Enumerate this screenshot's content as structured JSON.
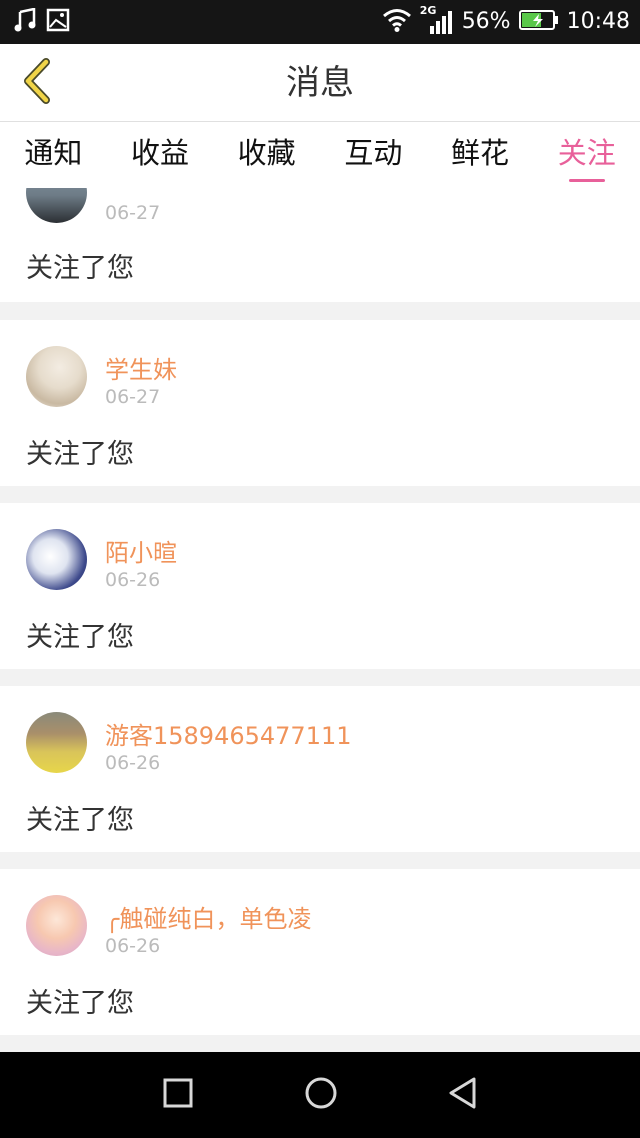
{
  "status_bar": {
    "battery": "56%",
    "time": "10:48",
    "network": "2G",
    "icons": [
      "music-icon",
      "image-icon",
      "wifi-icon",
      "signal-icon",
      "battery-icon"
    ]
  },
  "header": {
    "title": "消息",
    "back_icon": "chevron-left-icon"
  },
  "tabs": [
    {
      "label": "通知"
    },
    {
      "label": "收益"
    },
    {
      "label": "收藏"
    },
    {
      "label": "互动"
    },
    {
      "label": "鲜花"
    },
    {
      "label": "关注",
      "active": true
    }
  ],
  "items": [
    {
      "name": "",
      "date": "06-27",
      "text": "关注了您"
    },
    {
      "name": "学生妹",
      "date": "06-27",
      "text": "关注了您"
    },
    {
      "name": "陌小暄",
      "date": "06-26",
      "text": "关注了您"
    },
    {
      "name": "游客1589465477111",
      "date": "06-26",
      "text": "关注了您"
    },
    {
      "name": "╭触碰纯白，单色凌",
      "date": "06-26",
      "text": "关注了您"
    }
  ],
  "colors": {
    "accent": "#e8609a",
    "username": "#f0935a",
    "back_icon": "#f0d448"
  },
  "nav_bar": {
    "icons": [
      "recent-apps-icon",
      "home-icon",
      "back-triangle-icon"
    ]
  }
}
